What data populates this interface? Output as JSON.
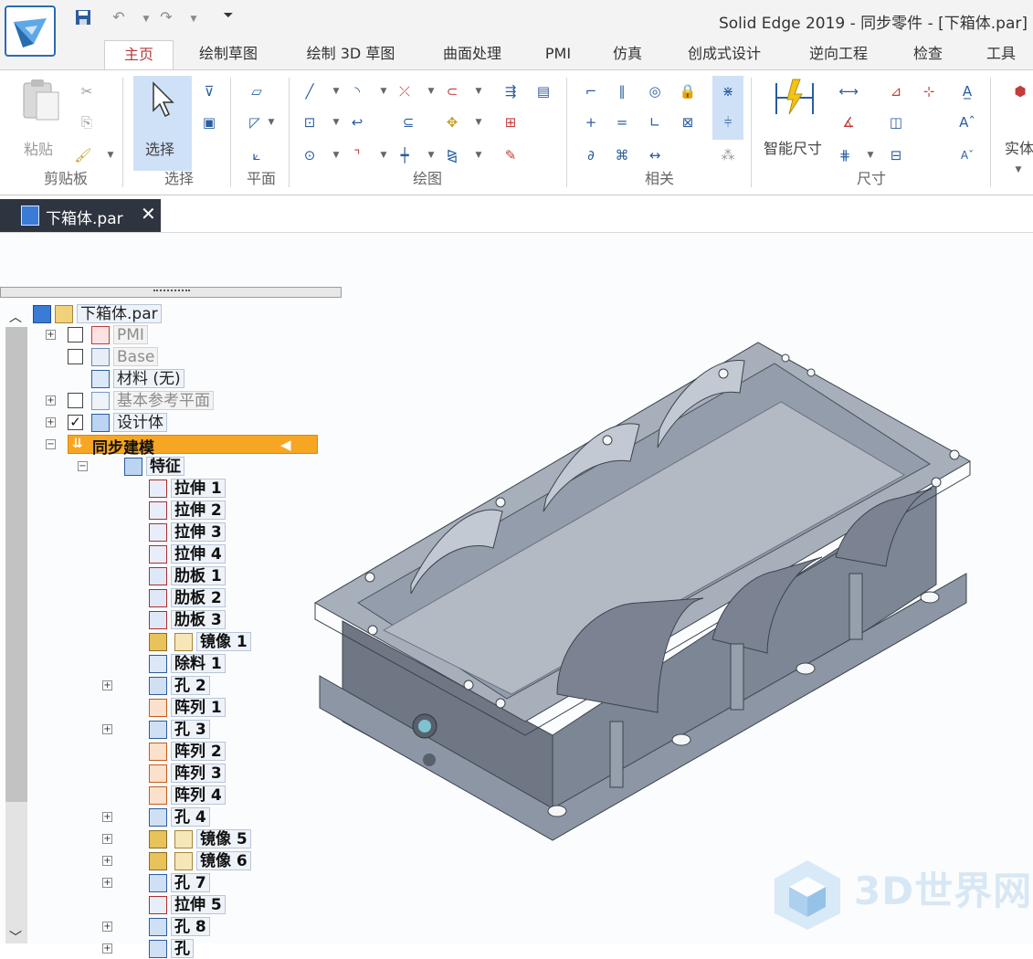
{
  "window": {
    "title": "Solid Edge 2019 - 同步零件 - [下箱体.par]"
  },
  "tabs": [
    {
      "label": "主页",
      "active": true
    },
    {
      "label": "绘制草图"
    },
    {
      "label": "绘制 3D 草图"
    },
    {
      "label": "曲面处理"
    },
    {
      "label": "PMI"
    },
    {
      "label": "仿真"
    },
    {
      "label": "创成式设计"
    },
    {
      "label": "逆向工程"
    },
    {
      "label": "检查"
    },
    {
      "label": "工具"
    }
  ],
  "ribbon": {
    "paste_label": "粘贴",
    "select_label": "选择",
    "smart_dimension_label": "智能尺寸",
    "solid_label": "实体",
    "groups": {
      "clipboard": "剪贴板",
      "select": "选择",
      "plane": "平面",
      "draw": "绘图",
      "relate": "相关",
      "dimension": "尺寸"
    }
  },
  "document_tab": {
    "label": "下箱体.par",
    "close_glyph": "✕"
  },
  "pathfinder": {
    "root": "下箱体.par",
    "nodes": [
      {
        "label": "PMI",
        "dim": true
      },
      {
        "label": "Base",
        "dim": true
      },
      {
        "label": "材料 (无)"
      },
      {
        "label": "基本参考平面",
        "dim": true
      },
      {
        "label": "设计体",
        "checked": true
      },
      {
        "label": "同步建模",
        "highlight": true
      },
      {
        "label": "特征"
      }
    ],
    "features": [
      {
        "label": "拉伸 1",
        "icon": "extrude-icon"
      },
      {
        "label": "拉伸 2",
        "icon": "extrude-icon"
      },
      {
        "label": "拉伸 3",
        "icon": "extrude-icon"
      },
      {
        "label": "拉伸 4",
        "icon": "extrude-icon"
      },
      {
        "label": "肋板 1",
        "icon": "rib-icon"
      },
      {
        "label": "肋板 2",
        "icon": "rib-icon"
      },
      {
        "label": "肋板 3",
        "icon": "rib-icon"
      },
      {
        "label": "镜像 1",
        "icon": "mirror-icon",
        "locked": true
      },
      {
        "label": "除料 1",
        "icon": "cutout-icon"
      },
      {
        "label": "孔 2",
        "icon": "hole-icon",
        "expandable": true
      },
      {
        "label": "阵列 1",
        "icon": "pattern-icon"
      },
      {
        "label": "孔 3",
        "icon": "hole-icon",
        "expandable": true
      },
      {
        "label": "阵列 2",
        "icon": "pattern-icon"
      },
      {
        "label": "阵列 3",
        "icon": "pattern-icon"
      },
      {
        "label": "阵列 4",
        "icon": "pattern-icon"
      },
      {
        "label": "孔 4",
        "icon": "hole-icon",
        "expandable": true
      },
      {
        "label": "镜像 5",
        "icon": "mirror-icon",
        "locked": true,
        "expandable": true
      },
      {
        "label": "镜像 6",
        "icon": "mirror-icon",
        "locked": true,
        "expandable": true
      },
      {
        "label": "孔 7",
        "icon": "hole-icon",
        "expandable": true
      },
      {
        "label": "拉伸 5",
        "icon": "extrude-icon"
      },
      {
        "label": "孔 8",
        "icon": "hole-icon",
        "expandable": true
      },
      {
        "label": "孔",
        "icon": "hole-icon",
        "expandable": true
      }
    ]
  },
  "watermark": {
    "text": "3D世界网"
  },
  "colors": {
    "highlight": "#f7a623",
    "model": "#8e97a5",
    "accent": "#2b6cb0"
  }
}
